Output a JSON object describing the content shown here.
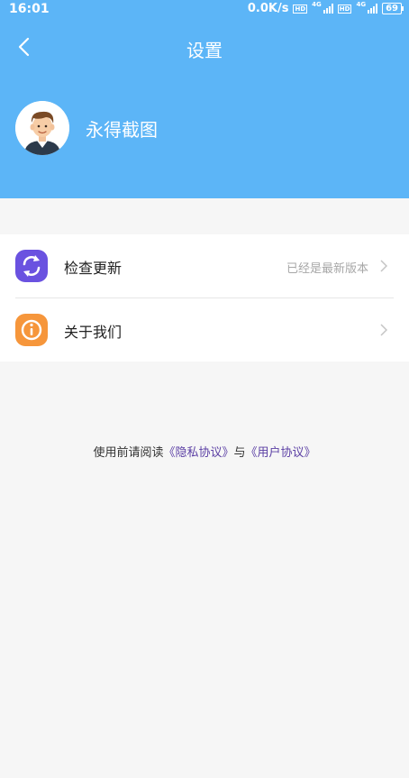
{
  "status_bar": {
    "time": "16:01",
    "speed": "0.0K/s",
    "battery": "69",
    "network": "4G",
    "hd": "HD"
  },
  "header": {
    "title": "设置"
  },
  "profile": {
    "username": "永得截图"
  },
  "settings": [
    {
      "label": "检查更新",
      "value": "已经是最新版本",
      "icon": "refresh-icon",
      "icon_color": "#6a52e0"
    },
    {
      "label": "关于我们",
      "value": "",
      "icon": "info-icon",
      "icon_color": "#f6963b"
    }
  ],
  "agreement": {
    "prefix": "使用前请阅读",
    "privacy": "《隐私协议》",
    "conjunction": "与",
    "user": "《用户协议》"
  },
  "colors": {
    "header": "#5cb5f7",
    "link": "#5b3fa4"
  }
}
